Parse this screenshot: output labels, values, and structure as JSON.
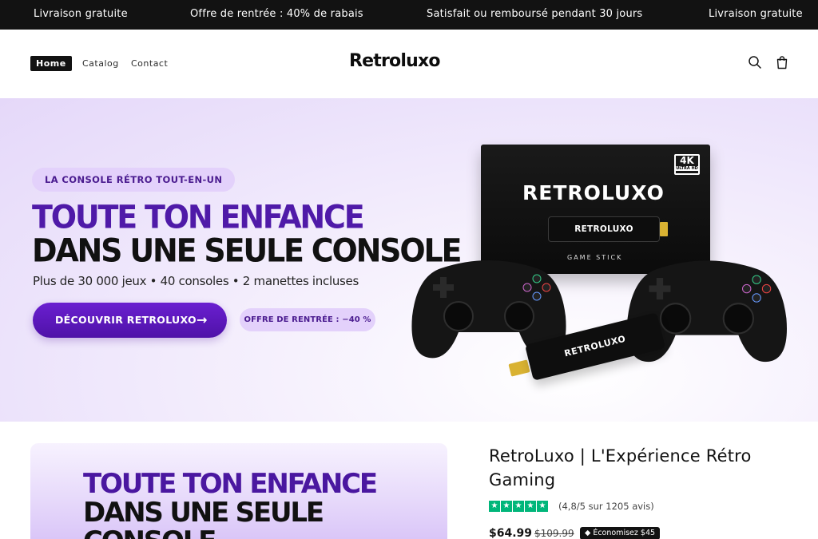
{
  "announcement": {
    "items": [
      "Livraison gratuite",
      "Offre de rentrée : 40% de rabais",
      "Satisfait ou remboursé pendant 30 jours",
      "Livraison gratuite"
    ]
  },
  "header": {
    "nav": [
      "Home",
      "Catalog",
      "Contact"
    ],
    "logo": "Retroluxo",
    "icons": [
      "search-icon",
      "cart-icon"
    ]
  },
  "hero": {
    "eyebrow": "LA CONSOLE RÉTRO TOUT-EN-UN",
    "headline_line1": "TOUTE TON ENFANCE",
    "headline_line2": "DANS UNE SEULE CONSOLE",
    "subline": "Plus de 30 000 jeux • 40 consoles • 2 manettes incluses",
    "cta_label": "DÉCOUVRIR RETROLUXO",
    "cta_arrow": "→",
    "offer_label": "OFFRE DE RENTRÉE : −40 %",
    "box_brand": "RETROLUXO",
    "box_badge": "4K",
    "box_badge_sub": "ULTRA HD",
    "box_stick_label": "RETROLUXO",
    "box_game_label": "GAME STICK",
    "stick_label": "RETROLUXO"
  },
  "product": {
    "image_headline_line1": "TOUTE TON ENFANCE",
    "image_headline_line2": "DANS UNE SEULE CONSOLE",
    "title": "RetroLuxo | L'Expérience Rétro Gaming",
    "rating_text": "(4,8/5 sur 1205 avis)",
    "price": "$64.99",
    "compare_price": "$109.99",
    "save_badge": "Économisez $45",
    "colors": {
      "accent": "#5a17b8",
      "trustpilot": "#00b67a"
    }
  }
}
